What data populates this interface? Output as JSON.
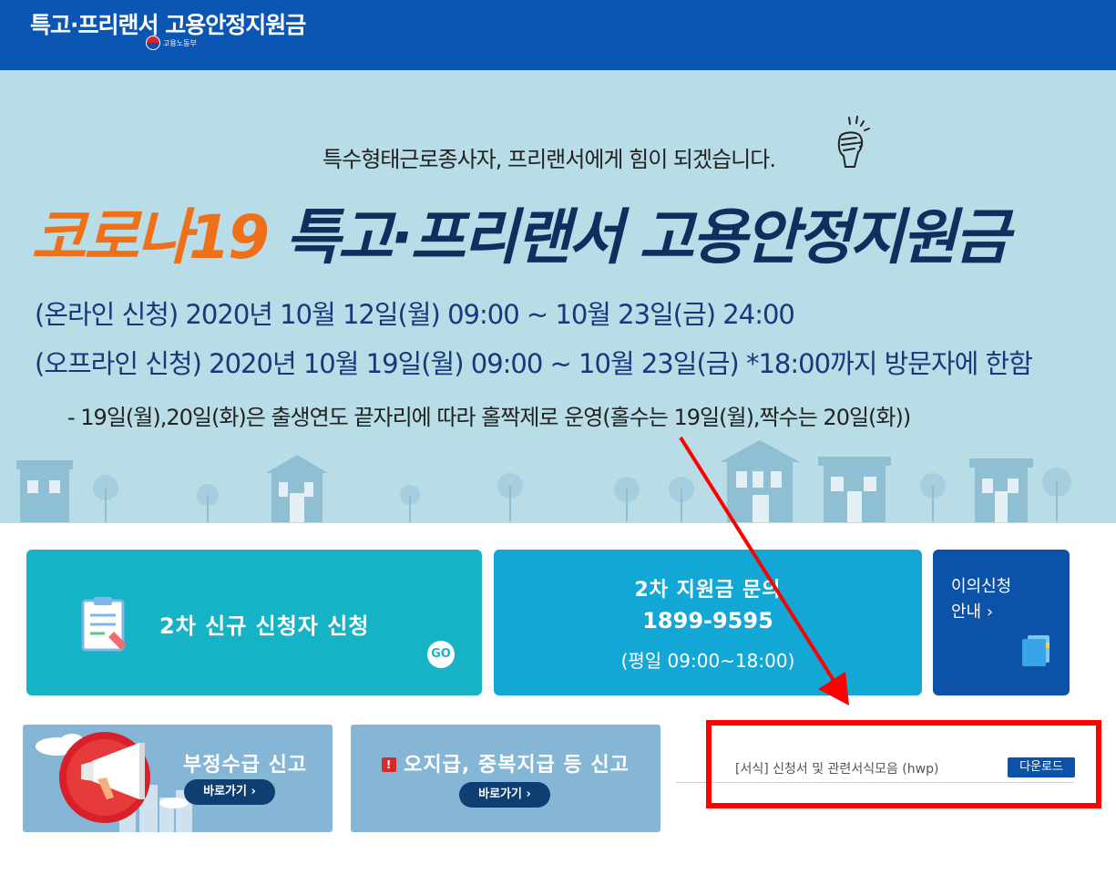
{
  "header": {
    "title": "특고·프리랜서 고용안정지원금",
    "ministry": "고용노동부",
    "bg_color": "#0b56b3"
  },
  "banner": {
    "tagline": "특수형태근로종사자, 프리랜서에게 힘이 되겠습니다.",
    "title_prefix": "코로나19",
    "title_main": "특고·프리랜서 고용안정지원금",
    "online_period": "(온라인 신청) 2020년 10월 12일(월) 09:00 ~ 10월 23일(금) 24:00",
    "offline_period": "(오프라인 신청) 2020년 10월 19일(월) 09:00 ~ 10월 23일(금) *18:00까지 방문자에 한함",
    "note": "- 19일(월),20일(화)은 출생연도 끝자리에 따라 홀짝제로 운영(홀수는 19일(월),짝수는 20일(화))",
    "bg_color": "#b8dde7"
  },
  "cards": {
    "apply": {
      "label": "2차 신규 신청자 신청",
      "go": "GO",
      "icon": "clipboard-icon"
    },
    "inquiry": {
      "title": "2차 지원금 문의",
      "phone": "1899-9595",
      "hours": "(평일 09:00~18:00)"
    },
    "appeal": {
      "line1": "이의신청",
      "line2": "안내 ›",
      "icon": "folder-icon"
    },
    "fraud": {
      "label": "부정수급 신고",
      "button": "바로가기 ›",
      "icon": "megaphone-icon"
    },
    "overpay": {
      "label": "오지급, 중복지급 등 신고",
      "button": "바로가기 ›",
      "icon": "warning-icon"
    }
  },
  "downloads": [
    {
      "label": "[서식] 신청서 및 관련서식모음 (hwp)",
      "button": "다운로드"
    }
  ],
  "annotation": {
    "highlight_color": "#ff0000"
  }
}
